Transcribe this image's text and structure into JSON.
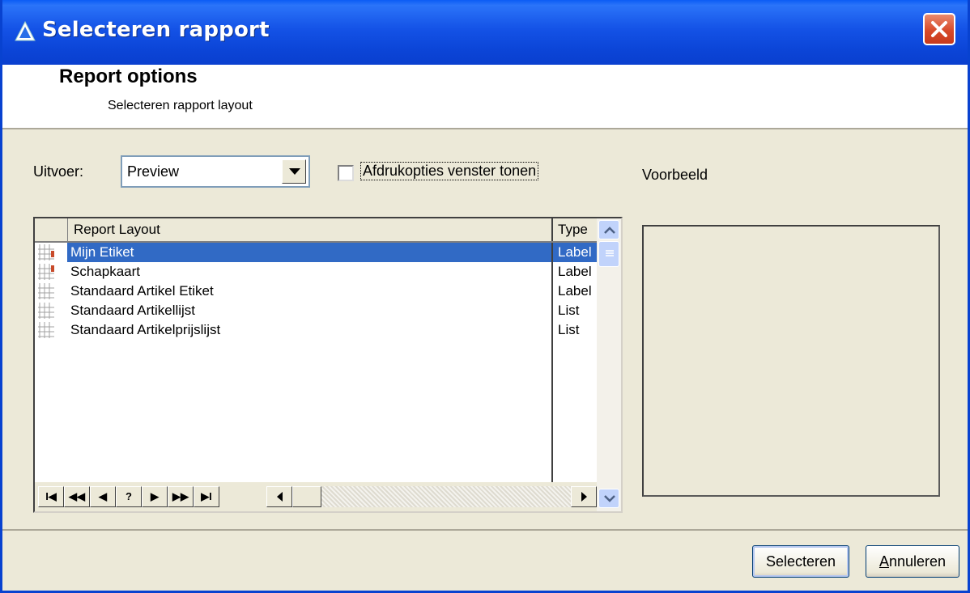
{
  "window": {
    "title": "Selecteren rapport"
  },
  "header": {
    "title": "Report options",
    "subtitle": "Selecteren rapport layout"
  },
  "output": {
    "label": "Uitvoer:",
    "value": "Preview"
  },
  "print_options": {
    "label": "Afdrukopties venster tonen",
    "checked": false
  },
  "grid": {
    "columns": [
      "Report Layout",
      "Type"
    ],
    "rows": [
      {
        "name": "Mijn Etiket",
        "type": "Label",
        "selected": true
      },
      {
        "name": "Schapkaart",
        "type": "Label",
        "selected": false
      },
      {
        "name": "Standaard Artikel Etiket",
        "type": "Label",
        "selected": false
      },
      {
        "name": "Standaard Artikellijst",
        "type": "List",
        "selected": false
      },
      {
        "name": "Standaard Artikelprijslijst",
        "type": "List",
        "selected": false
      }
    ],
    "navigator": [
      "I◀",
      "◀◀",
      "◀",
      "?",
      "▶",
      "▶▶",
      "▶I"
    ]
  },
  "preview": {
    "label": "Voorbeeld"
  },
  "buttons": {
    "select": "Selecteren",
    "cancel_underlined": "A",
    "cancel_rest": "nnuleren"
  },
  "colors": {
    "title_bar": "#0a4ee0",
    "selection": "#316ac5",
    "dialog_bg": "#ece9d8"
  }
}
